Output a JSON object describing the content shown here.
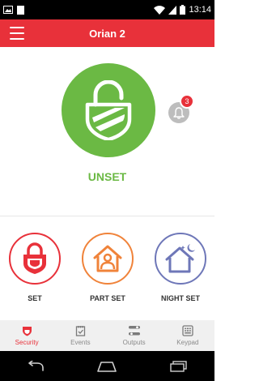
{
  "status_bar": {
    "time": "13:14",
    "icons": [
      "image-icon",
      "sim-icon",
      "wifi-icon",
      "cell-signal-icon",
      "battery-icon"
    ]
  },
  "app_bar": {
    "title": "Orian 2",
    "menu_icon": "hamburger-menu-icon"
  },
  "system_status": {
    "label": "UNSET",
    "icon": "unlocked-shield-icon",
    "color": "#6bb944"
  },
  "notifications": {
    "count": "3",
    "icon": "bell-icon"
  },
  "modes": [
    {
      "label": "SET",
      "icon": "lock-shield-icon",
      "color": "#e8313a"
    },
    {
      "label": "PART SET",
      "icon": "house-person-icon",
      "color": "#f0833a"
    },
    {
      "label": "NIGHT SET",
      "icon": "house-moon-icon",
      "color": "#6e77b8"
    }
  ],
  "bottom_nav": [
    {
      "label": "Security",
      "icon": "shield-icon",
      "active": true
    },
    {
      "label": "Events",
      "icon": "notepad-icon",
      "active": false
    },
    {
      "label": "Outputs",
      "icon": "toggles-icon",
      "active": false
    },
    {
      "label": "Keypad",
      "icon": "keypad-icon",
      "active": false
    }
  ],
  "colors": {
    "brand_red": "#e8313a",
    "unset_green": "#6bb944",
    "part_set_orange": "#f0833a",
    "night_set_blue": "#6e77b8"
  }
}
